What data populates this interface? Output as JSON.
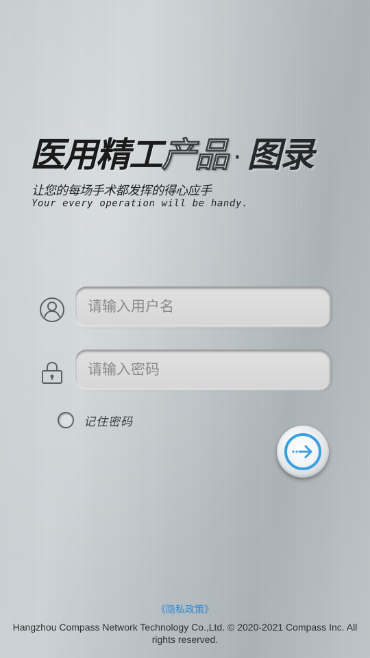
{
  "title": {
    "main": "医用精工",
    "fade": "产品",
    "separator": "·",
    "dark": "图录"
  },
  "slogan": {
    "cn": "让您的每场手术都发挥的得心应手",
    "en": "Your every operation will be handy."
  },
  "form": {
    "username": {
      "placeholder": "请输入用户名",
      "icon": "user-icon"
    },
    "password": {
      "placeholder": "请输入密码",
      "icon": "lock-icon"
    },
    "remember_label": "记住密码",
    "submit_icon": "arrow-right-icon"
  },
  "footer": {
    "privacy": "《隐私政策》",
    "copyright": "Hangzhou Compass Network Technology Co.,Ltd. © 2020-2021 Compass Inc. All rights reserved."
  },
  "colors": {
    "accent": "#3a9fe0",
    "link": "#2b8ad8"
  }
}
